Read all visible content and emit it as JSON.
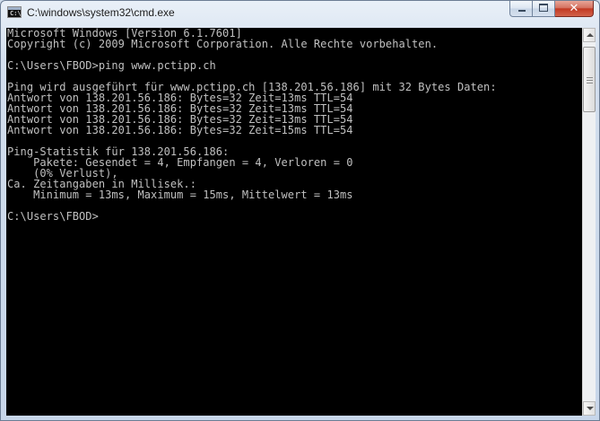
{
  "window": {
    "title": "C:\\windows\\system32\\cmd.exe",
    "icon_name": "cmd-icon",
    "icon_text": "C:\\",
    "close_glyph": "✕"
  },
  "console": {
    "lines": [
      "Microsoft Windows [Version 6.1.7601]",
      "Copyright (c) 2009 Microsoft Corporation. Alle Rechte vorbehalten.",
      "",
      "C:\\Users\\FBOD>ping www.pctipp.ch",
      "",
      "Ping wird ausgeführt für www.pctipp.ch [138.201.56.186] mit 32 Bytes Daten:",
      "Antwort von 138.201.56.186: Bytes=32 Zeit=13ms TTL=54",
      "Antwort von 138.201.56.186: Bytes=32 Zeit=13ms TTL=54",
      "Antwort von 138.201.56.186: Bytes=32 Zeit=13ms TTL=54",
      "Antwort von 138.201.56.186: Bytes=32 Zeit=15ms TTL=54",
      "",
      "Ping-Statistik für 138.201.56.186:",
      "    Pakete: Gesendet = 4, Empfangen = 4, Verloren = 0",
      "    (0% Verlust),",
      "Ca. Zeitangaben in Millisek.:",
      "    Minimum = 13ms, Maximum = 15ms, Mittelwert = 13ms",
      "",
      "C:\\Users\\FBOD>"
    ]
  },
  "colors": {
    "console_bg": "#000000",
    "console_fg": "#c0c0c0",
    "close_red": "#c23a23"
  }
}
